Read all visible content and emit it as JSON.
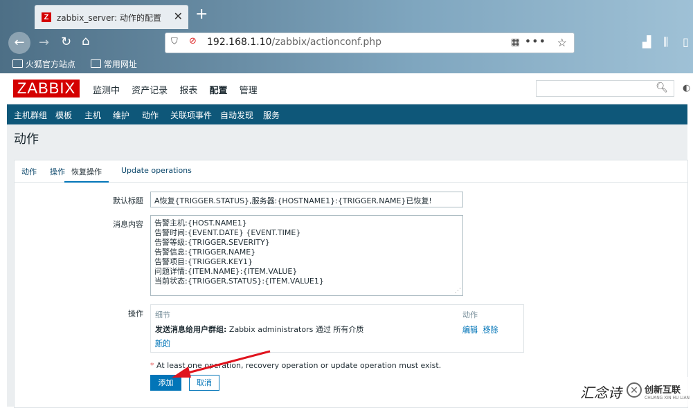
{
  "browser": {
    "tab_title": "zabbix_server: 动作的配置",
    "tab_favicon": "Z",
    "url_host": "192.168.1.10",
    "url_path": "/zabbix/actionconf.php",
    "bookmarks": [
      "火狐官方站点",
      "常用网址"
    ]
  },
  "header": {
    "logo": "ZABBIX",
    "menu": [
      "监测中",
      "资产记录",
      "报表",
      "配置",
      "管理"
    ],
    "active_menu": "配置",
    "submenu": [
      "主机群组",
      "模板",
      "主机",
      "维护",
      "动作",
      "关联项事件",
      "自动发现",
      "服务"
    ],
    "active_submenu": "动作"
  },
  "page_title": "动作",
  "tabs": [
    "动作",
    "操作",
    "恢复操作",
    "Update operations"
  ],
  "active_tab": "恢复操作",
  "form": {
    "subject_label": "默认标题",
    "subject_value": "A恢复{TRIGGER.STATUS},服务器:{HOSTNAME1}:{TRIGGER.NAME}已恢复!",
    "message_label": "消息内容",
    "message_lines": [
      "告警主机:{HOST.NAME1}",
      "告警时间:{EVENT.DATE} {EVENT.TIME}",
      "告警等级:{TRIGGER.SEVERITY}",
      "告警信息:{TRIGGER.NAME}",
      "告警项目:{TRIGGER.KEY1}",
      "问题详情:{ITEM.NAME}:{ITEM.VALUE}",
      "当前状态:{TRIGGER.STATUS}:{ITEM.VALUE1}"
    ],
    "operations_label": "操作",
    "operations": {
      "col_details": "细节",
      "col_action": "动作",
      "row_bold": "发送消息给用户群组:",
      "row_text": " Zabbix administrators 通过 所有介质",
      "edit": "编辑",
      "remove": "移除",
      "new": "新的"
    },
    "note_asterisk": "*",
    "note": "At least one operation, recovery operation or update operation must exist.",
    "add_button": "添加",
    "cancel_button": "取消"
  },
  "overlay": {
    "watermark": "汇念诗",
    "brand_name": "创新互联",
    "brand_sub": "CHUANG XIN HU LIAN"
  },
  "colors": {
    "zabbix_red": "#d40000",
    "submenu_bg": "#0e5779",
    "primary": "#0275b8",
    "arrow": "#e0141e"
  }
}
